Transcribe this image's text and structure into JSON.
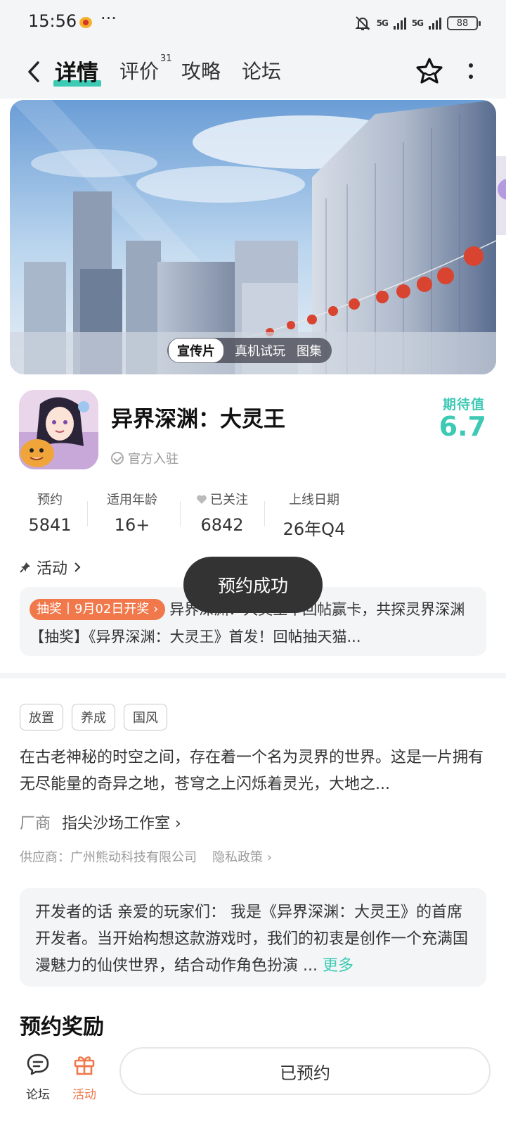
{
  "status_bar": {
    "time": "15:56",
    "more": "···",
    "signal1": "5G",
    "signal2": "5G",
    "battery": "88"
  },
  "nav": {
    "tabs": [
      {
        "label": "详情",
        "active": true
      },
      {
        "label": "评价",
        "badge": "31"
      },
      {
        "label": "攻略"
      },
      {
        "label": "论坛"
      }
    ]
  },
  "hero": {
    "media_tabs": [
      {
        "label": "宣传片",
        "active": true
      },
      {
        "label": "真机试玩"
      },
      {
        "label": "图集"
      }
    ]
  },
  "game": {
    "title": "异界深渊：大灵王",
    "verified": "官方入驻",
    "expect_label": "期待值",
    "expect_value": "6.7"
  },
  "stats": [
    {
      "label": "预约",
      "value": "5841"
    },
    {
      "label": "适用年龄",
      "value": "16+"
    },
    {
      "label": "已关注",
      "value": "6842"
    },
    {
      "label": "上线日期",
      "value": "26年Q4"
    }
  ],
  "activity": {
    "header": "活动",
    "badge": "抽奖丨9月02日开奖 ›",
    "text": "异界深渊：大灵王丨回帖赢卡，共探灵界深渊 【抽奖】《异界深渊：大灵王》首发！回帖抽天猫..."
  },
  "toast": "预约成功",
  "tags": [
    "放置",
    "养成",
    "国风"
  ],
  "description": "在古老神秘的时空之间，存在着一个名为灵界的世界。这是一片拥有无尽能量的奇异之地，苍穹之上闪烁着灵光，大地之...",
  "vendor": {
    "label": "厂商",
    "value": "指尖沙场工作室 ›"
  },
  "supplier": {
    "text": "供应商：广州熊动科技有限公司",
    "privacy": "隐私政策 ›"
  },
  "developer": {
    "text": "开发者的话  亲爱的玩家们： 我是《异界深渊：大灵王》的首席开发者。当开始构想这款游戏时，我们的初衷是创作一个充满国漫魅力的仙侠世界，结合动作角色扮演 ...",
    "more": "更多"
  },
  "reward_title": "预约奖励",
  "bottom_bar": {
    "forum": "论坛",
    "activity": "活动",
    "reserve_button": "已预约"
  },
  "colors": {
    "accent": "#3dcab4",
    "orange": "#f0784b",
    "toast_bg": "#333333"
  }
}
